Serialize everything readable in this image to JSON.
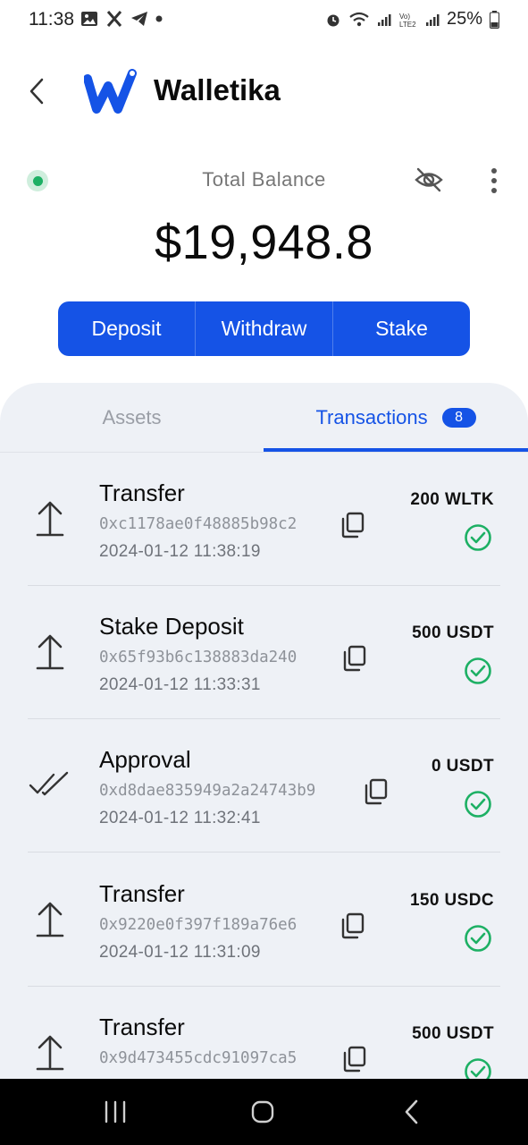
{
  "status_bar": {
    "time": "11:38",
    "battery": "25%",
    "left_icons": [
      "gallery-icon",
      "x-icon",
      "telegram-icon",
      "dot-icon"
    ],
    "right_icons": [
      "alarm-icon",
      "wifi-icon",
      "signal-icon",
      "volte-icon",
      "signal-icon",
      "battery-icon"
    ]
  },
  "header": {
    "app_name": "Walletika"
  },
  "balance": {
    "label": "Total Balance",
    "amount": "$19,948.8"
  },
  "actions": {
    "deposit": "Deposit",
    "withdraw": "Withdraw",
    "stake": "Stake"
  },
  "tabs": {
    "assets": "Assets",
    "transactions": "Transactions",
    "transactions_count": "8",
    "active": "transactions"
  },
  "transactions": [
    {
      "type": "Transfer",
      "hash": "0xc1178ae0f48885b98c2",
      "date": "2024-01-12 11:38:19",
      "amount": "200 WLTK",
      "icon": "upload-arrow-icon",
      "status": "success"
    },
    {
      "type": "Stake Deposit",
      "hash": "0x65f93b6c138883da240",
      "date": "2024-01-12 11:33:31",
      "amount": "500 USDT",
      "icon": "upload-arrow-icon",
      "status": "success"
    },
    {
      "type": "Approval",
      "hash": "0xd8dae835949a2a24743b9",
      "date": "2024-01-12 11:32:41",
      "amount": "0 USDT",
      "icon": "double-check-icon",
      "status": "success"
    },
    {
      "type": "Transfer",
      "hash": "0x9220e0f397f189a76e6",
      "date": "2024-01-12 11:31:09",
      "amount": "150 USDC",
      "icon": "upload-arrow-icon",
      "status": "success"
    },
    {
      "type": "Transfer",
      "hash": "0x9d473455cdc91097ca5",
      "date": "",
      "amount": "500 USDT",
      "icon": "upload-arrow-icon",
      "status": "success"
    }
  ],
  "colors": {
    "primary": "#1553e6",
    "success": "#1db064",
    "panel_bg": "#eef1f6"
  }
}
